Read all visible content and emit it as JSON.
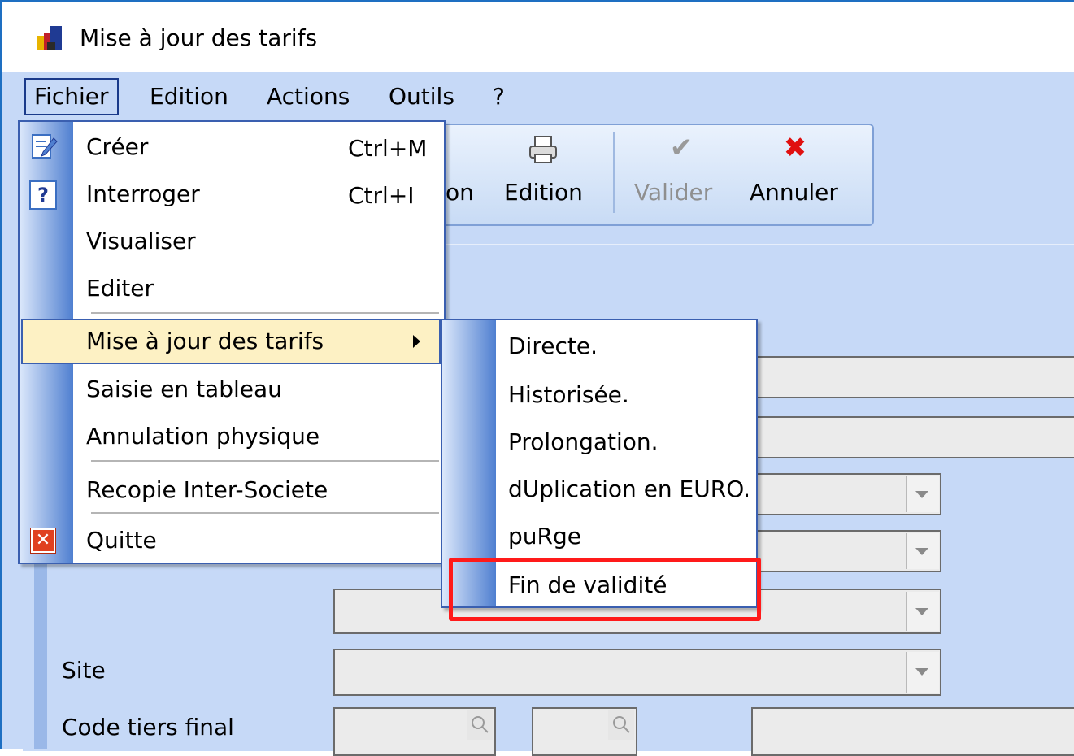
{
  "window": {
    "title": "Mise à jour des tarifs"
  },
  "menubar": {
    "items": [
      {
        "label": "Fichier"
      },
      {
        "label": "Edition"
      },
      {
        "label": "Actions"
      },
      {
        "label": "Outils"
      },
      {
        "label": "?"
      }
    ]
  },
  "toolbar": {
    "partial_label": "on",
    "edition_label": "Edition",
    "valider_label": "Valider",
    "annuler_label": "Annuler"
  },
  "file_menu": {
    "items": [
      {
        "label": "Créer",
        "shortcut": "Ctrl+M",
        "icon": "edit-document-icon"
      },
      {
        "label": "Interroger",
        "shortcut": "Ctrl+I",
        "icon": "question-icon"
      },
      {
        "label": "Visualiser"
      },
      {
        "label": "Editer"
      },
      {
        "label": "Mise à jour des tarifs",
        "has_submenu": true
      },
      {
        "label": "Saisie en tableau"
      },
      {
        "label": "Annulation physique"
      },
      {
        "label": "Recopie Inter-Societe"
      },
      {
        "label": "Quitte",
        "icon": "close-icon"
      }
    ]
  },
  "submenu": {
    "items": [
      {
        "label": "Directe."
      },
      {
        "label": "Historisée."
      },
      {
        "label": "Prolongation."
      },
      {
        "label": "dUplication en EURO."
      },
      {
        "label": "puRge"
      },
      {
        "label": "Fin de validité"
      }
    ]
  },
  "form": {
    "site_label": "Site",
    "code_tiers_label": "Code tiers final"
  },
  "colors": {
    "accent_border": "#3a5fb0",
    "highlight": "#fdf1c4",
    "annotation_red": "#ff1a1a",
    "client_background": "#c6d9f7"
  }
}
